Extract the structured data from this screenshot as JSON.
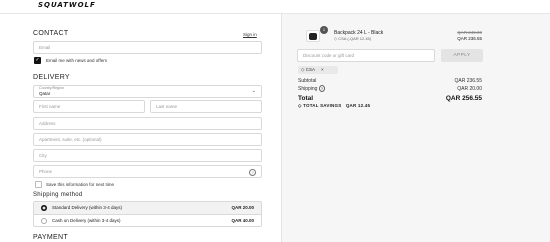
{
  "header": {
    "brand": "SQUATWOLF"
  },
  "contact": {
    "title": "CONTACT",
    "signin": "Sign in",
    "email_placeholder": "Email",
    "news_label": "Email me with news and offers"
  },
  "delivery": {
    "title": "DELIVERY",
    "country_label": "Country/Region",
    "country_value": "Qatar",
    "first_name": "First name",
    "last_name": "Last name",
    "address": "Address",
    "apartment": "Apartment, suite, etc. (optional)",
    "city": "City",
    "phone": "Phone",
    "save_label": "Save this information for next time"
  },
  "shipping": {
    "title": "Shipping method",
    "options": [
      {
        "name": "Standard Delivery (within 3-4 days)",
        "price": "QAR 20.00",
        "selected": true
      },
      {
        "name": "Cash on Delivery (within 3-4 days)",
        "price": "QAR 40.00",
        "selected": false
      }
    ]
  },
  "payment": {
    "title": "PAYMENT"
  },
  "summary": {
    "item": {
      "quantity": "1",
      "name": "Backpack 24 L - Black",
      "tag": "CSA (-QAR 12.45)",
      "old_price": "QAR 249.00",
      "price": "QAR 236.55"
    },
    "discount_placeholder": "Discount code or gift card",
    "apply_label": "APPLY",
    "chip_label": "CSA",
    "subtotal_label": "Subtotal",
    "subtotal_value": "QAR 236.55",
    "shipping_label": "Shipping",
    "shipping_value": "QAR 20.00",
    "total_label": "Total",
    "total_value": "QAR 256.55",
    "savings_label": "TOTAL SAVINGS",
    "savings_value": "QAR 12.45"
  },
  "colors": {
    "accent": "#111111",
    "panel": "#f6f6f6",
    "border": "#d9d9d9"
  }
}
